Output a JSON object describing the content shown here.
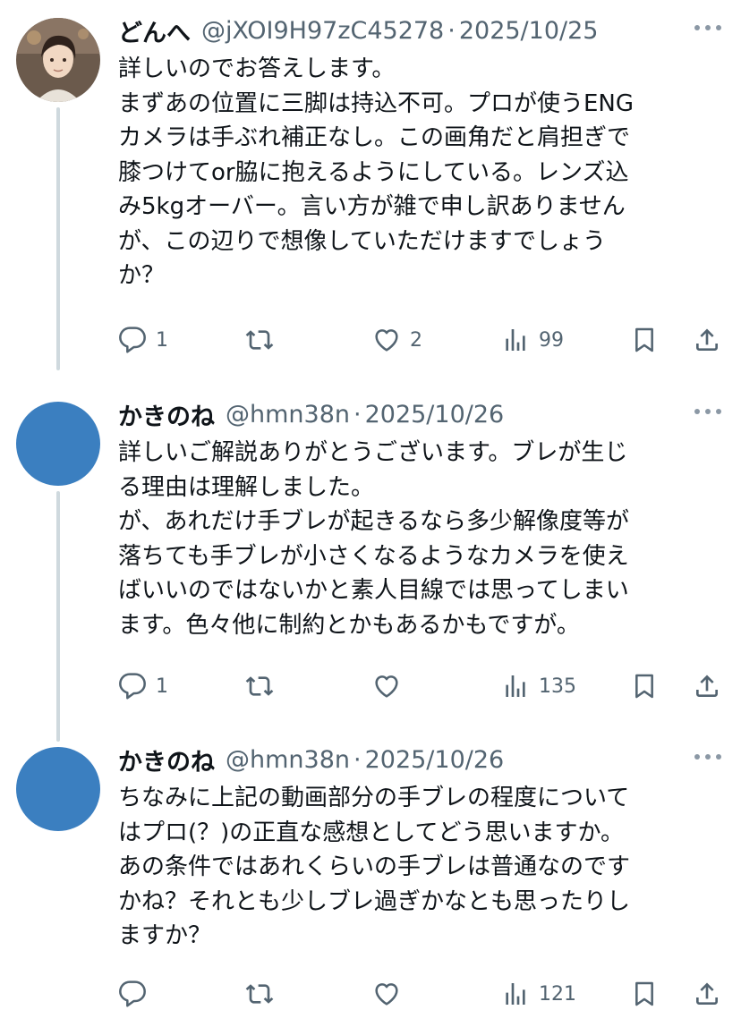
{
  "tweets": [
    {
      "name": "どんへ",
      "handle": "@jXOI9H97zC45278",
      "separator": "·",
      "date": "2025/10/25",
      "lines": [
        "詳しいのでお答えします。",
        "まずあの位置に三脚は持込不可。プロが使うENG",
        "カメラは手ぶれ補正なし。この画角だと肩担ぎで",
        "膝つけてor脇に抱えるようにしている。レンズ込",
        "み5kgオーバー。言い方が雑で申し訳ありません",
        "が、この辺りで想像していただけますでしょう",
        "か？"
      ],
      "replies": "1",
      "retweets": "",
      "likes": "2",
      "views": "99"
    },
    {
      "name": "かきのね",
      "handle": "@hmn38n",
      "separator": "·",
      "date": "2025/10/26",
      "lines": [
        "詳しいご解説ありがとうございます。ブレが生じ",
        "る理由は理解しました。",
        "が、あれだけ手ブレが起きるなら多少解像度等が",
        "落ちても手ブレが小さくなるようなカメラを使え",
        "ばいいのではないかと素人目線では思ってしまい",
        "ます。色々他に制約とかもあるかもですが。"
      ],
      "replies": "1",
      "retweets": "",
      "likes": "",
      "views": "135"
    },
    {
      "name": "かきのね",
      "handle": "@hmn38n",
      "separator": "·",
      "date": "2025/10/26",
      "lines": [
        "ちなみに上記の動画部分の手ブレの程度について",
        "はプロ(？)の正直な感想としてどう思いますか。",
        "あの条件ではあれくらいの手ブレは普通なのです",
        "かね？それとも少しブレ過ぎかなとも思ったりし",
        "ますか？"
      ],
      "replies": "",
      "retweets": "",
      "likes": "",
      "views": "121"
    }
  ],
  "colors": {
    "text": "#0f1419",
    "muted": "#536471",
    "icon": "#536471",
    "avatar_default": "#3b7fc0",
    "thread_line": "#cfd9de"
  },
  "icons": [
    "reply-icon",
    "retweet-icon",
    "like-icon",
    "views-icon",
    "bookmark-icon",
    "share-icon",
    "more-icon"
  ]
}
